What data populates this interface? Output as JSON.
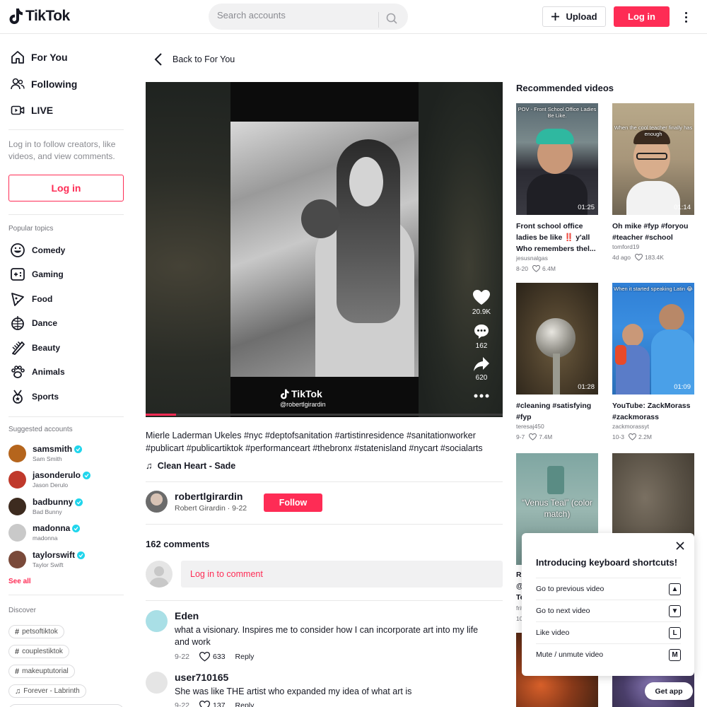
{
  "header": {
    "logo_text": "TikTok",
    "search_placeholder": "Search accounts",
    "upload_label": "Upload",
    "login_label": "Log in"
  },
  "sidebar": {
    "nav": [
      {
        "label": "For You",
        "icon": "home-icon"
      },
      {
        "label": "Following",
        "icon": "people-icon"
      },
      {
        "label": "LIVE",
        "icon": "live-icon"
      }
    ],
    "login_note": "Log in to follow creators, like videos, and view comments.",
    "login_button": "Log in",
    "popular_heading": "Popular topics",
    "topics": [
      {
        "label": "Comedy",
        "icon": "smile-icon"
      },
      {
        "label": "Gaming",
        "icon": "gamepad-icon"
      },
      {
        "label": "Food",
        "icon": "pizza-icon"
      },
      {
        "label": "Dance",
        "icon": "disco-ball-icon"
      },
      {
        "label": "Beauty",
        "icon": "comb-icon"
      },
      {
        "label": "Animals",
        "icon": "paw-icon"
      },
      {
        "label": "Sports",
        "icon": "medal-icon"
      }
    ],
    "suggested_heading": "Suggested accounts",
    "accounts": [
      {
        "username": "samsmith",
        "name": "Sam Smith",
        "color": "#b5651d"
      },
      {
        "username": "jasonderulo",
        "name": "Jason Derulo",
        "color": "#c0392b"
      },
      {
        "username": "badbunny",
        "name": "Bad Bunny",
        "color": "#3d2b1f"
      },
      {
        "username": "madonna",
        "name": "madonna",
        "color": "#c9c9c9"
      },
      {
        "username": "taylorswift",
        "name": "Taylor Swift",
        "color": "#7a4a3a"
      }
    ],
    "see_all": "See all",
    "discover_heading": "Discover",
    "discover": [
      {
        "label": "petsoftiktok",
        "icon": "hashtag-icon"
      },
      {
        "label": "couplestiktok",
        "icon": "hashtag-icon"
      },
      {
        "label": "makeuptutorial",
        "icon": "hashtag-icon"
      },
      {
        "label": "Forever - Labrinth",
        "icon": "music-note-icon"
      }
    ]
  },
  "main": {
    "back_label": "Back to For You",
    "video": {
      "watermark_logo": "TikTok",
      "watermark_user": "@robertlgirardin",
      "likes": "20.9K",
      "comments": "162",
      "shares": "620",
      "progress": 0.085
    },
    "caption": "Mierle Laderman Ukeles #nyc #deptofsanitation #artistinresidence #sanitationworker #publicart #publicartiktok #performanceart #thebronx #statenisland #nycart #socialarts",
    "music": "Clean Heart - Sade",
    "author": {
      "username": "robertlgirardin",
      "subline": "Robert Girardin · 9-22",
      "follow_label": "Follow"
    },
    "comments_count": "162 comments",
    "comment_placeholder": "Log in to comment",
    "comments": [
      {
        "name": "Eden",
        "text": "what a visionary. Inspires me to consider how I can incorporate art into my life and work",
        "date": "9-22",
        "likes": "633",
        "reply": "Reply"
      },
      {
        "name": "user710165",
        "text": "She was like THE artist who expanded my idea of what art is",
        "date": "9-22",
        "likes": "137",
        "reply": "Reply"
      }
    ]
  },
  "recommended": {
    "title": "Recommended videos",
    "videos": [
      {
        "overlay": "POV - Front School Office Ladies Be Like.",
        "duration": "01:25",
        "caption": "Front school office ladies be like ‼️ y'all Who remembers thel...",
        "user": "jesusnalgas",
        "date": "8-20",
        "likes": "6.4M"
      },
      {
        "overlay": "When the cool teacher finally has enough",
        "duration": "01:14",
        "caption": "Oh mike #fyp #foryou #teacher #school",
        "user": "tomford19",
        "date": "4d ago",
        "likes": "183.4K"
      },
      {
        "overlay": "",
        "duration": "01:28",
        "caption": "#cleaning #satisfying #fyp",
        "user": "teresaj450",
        "date": "9-7",
        "likes": "7.4M"
      },
      {
        "overlay": "When it started speaking Latin 😂",
        "duration": "01:09",
        "caption": "YouTube: ZackMorass #zackmorass",
        "user": "zackmorassyt",
        "date": "10-3",
        "likes": "2.2M"
      },
      {
        "overlay": "“Venus Teal” (color match)",
        "duration": "",
        "caption": "Re",
        "caption2": "@",
        "caption3": "Te",
        "user": "frit",
        "date": "10",
        "likes": ""
      },
      {
        "overlay": "",
        "duration": "",
        "caption": "",
        "user": "",
        "date": "",
        "likes": ""
      }
    ]
  },
  "shortcuts": {
    "title": "Introducing keyboard shortcuts!",
    "rows": [
      {
        "label": "Go to previous video",
        "key": "▲"
      },
      {
        "label": "Go to next video",
        "key": "▼"
      },
      {
        "label": "Like video",
        "key": "L"
      },
      {
        "label": "Mute / unmute video",
        "key": "M"
      }
    ]
  },
  "get_app": "Get app",
  "colors": {
    "accent": "#fe2c55",
    "verified": "#20d5ec",
    "text": "#161823"
  }
}
